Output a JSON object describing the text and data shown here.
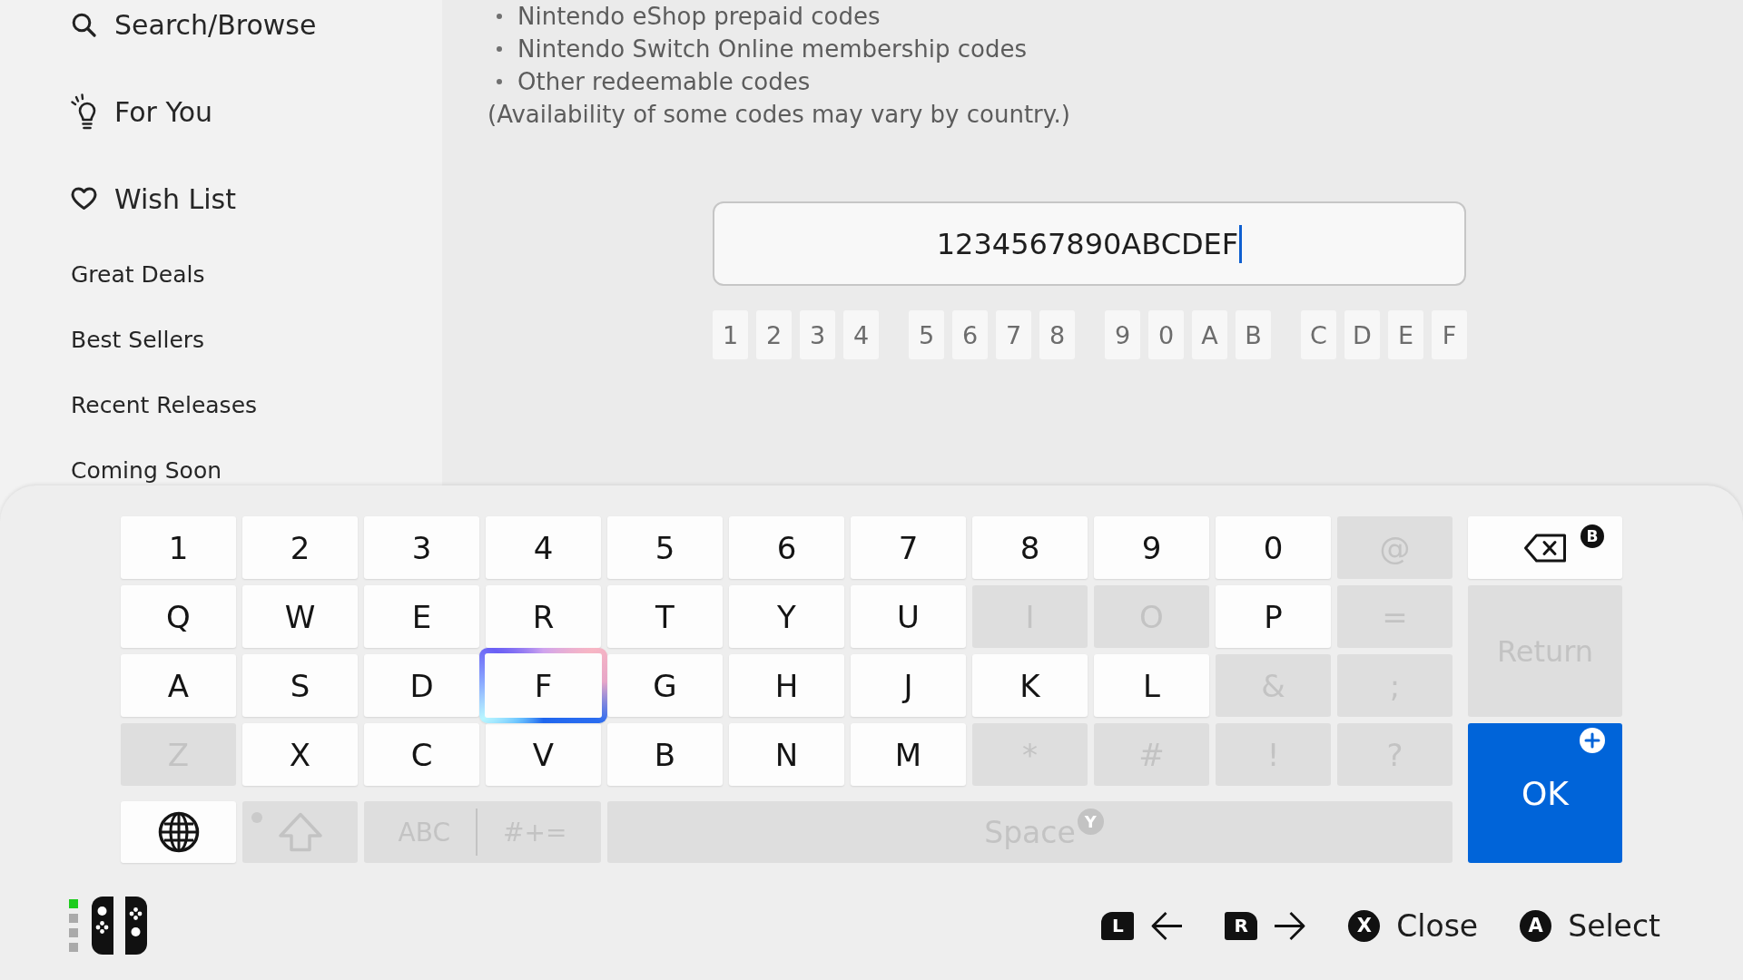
{
  "sidebar": {
    "items": [
      {
        "label": "Search/Browse",
        "kind": "main"
      },
      {
        "label": "For You",
        "kind": "main"
      },
      {
        "label": "Wish List",
        "kind": "main"
      },
      {
        "label": "Great Deals",
        "kind": "sub"
      },
      {
        "label": "Best Sellers",
        "kind": "sub"
      },
      {
        "label": "Recent Releases",
        "kind": "sub"
      },
      {
        "label": "Coming Soon",
        "kind": "sub"
      }
    ]
  },
  "content": {
    "code_types": [
      "Nintendo eShop prepaid codes",
      "Nintendo Switch Online membership codes",
      "Other redeemable codes"
    ],
    "note": "(Availability of some codes may vary by country.)",
    "code_field": {
      "value": "1234567890ABCDEF",
      "caret": true
    },
    "code_groups": [
      [
        "1",
        "2",
        "3",
        "4"
      ],
      [
        "5",
        "6",
        "7",
        "8"
      ],
      [
        "9",
        "0",
        "A",
        "B"
      ],
      [
        "C",
        "D",
        "E",
        "F"
      ]
    ]
  },
  "keyboard": {
    "rows": [
      [
        {
          "label": "1",
          "disabled": false,
          "selected": false
        },
        {
          "label": "2",
          "disabled": false,
          "selected": false
        },
        {
          "label": "3",
          "disabled": false,
          "selected": false
        },
        {
          "label": "4",
          "disabled": false,
          "selected": false
        },
        {
          "label": "5",
          "disabled": false,
          "selected": false
        },
        {
          "label": "6",
          "disabled": false,
          "selected": false
        },
        {
          "label": "7",
          "disabled": false,
          "selected": false
        },
        {
          "label": "8",
          "disabled": false,
          "selected": false
        },
        {
          "label": "9",
          "disabled": false,
          "selected": false
        },
        {
          "label": "0",
          "disabled": false,
          "selected": false
        },
        {
          "label": "@",
          "disabled": true,
          "selected": false
        }
      ],
      [
        {
          "label": "Q",
          "disabled": false,
          "selected": false
        },
        {
          "label": "W",
          "disabled": false,
          "selected": false
        },
        {
          "label": "E",
          "disabled": false,
          "selected": false
        },
        {
          "label": "R",
          "disabled": false,
          "selected": false
        },
        {
          "label": "T",
          "disabled": false,
          "selected": false
        },
        {
          "label": "Y",
          "disabled": false,
          "selected": false
        },
        {
          "label": "U",
          "disabled": false,
          "selected": false
        },
        {
          "label": "I",
          "disabled": true,
          "selected": false
        },
        {
          "label": "O",
          "disabled": true,
          "selected": false
        },
        {
          "label": "P",
          "disabled": false,
          "selected": false
        },
        {
          "label": "=",
          "disabled": true,
          "selected": false
        }
      ],
      [
        {
          "label": "A",
          "disabled": false,
          "selected": false
        },
        {
          "label": "S",
          "disabled": false,
          "selected": false
        },
        {
          "label": "D",
          "disabled": false,
          "selected": false
        },
        {
          "label": "F",
          "disabled": false,
          "selected": true
        },
        {
          "label": "G",
          "disabled": false,
          "selected": false
        },
        {
          "label": "H",
          "disabled": false,
          "selected": false
        },
        {
          "label": "J",
          "disabled": false,
          "selected": false
        },
        {
          "label": "K",
          "disabled": false,
          "selected": false
        },
        {
          "label": "L",
          "disabled": false,
          "selected": false
        },
        {
          "label": "&",
          "disabled": true,
          "selected": false
        },
        {
          "label": ";",
          "disabled": true,
          "selected": false
        }
      ],
      [
        {
          "label": "Z",
          "disabled": true,
          "selected": false
        },
        {
          "label": "X",
          "disabled": false,
          "selected": false
        },
        {
          "label": "C",
          "disabled": false,
          "selected": false
        },
        {
          "label": "V",
          "disabled": false,
          "selected": false
        },
        {
          "label": "B",
          "disabled": false,
          "selected": false
        },
        {
          "label": "N",
          "disabled": false,
          "selected": false
        },
        {
          "label": "M",
          "disabled": false,
          "selected": false
        },
        {
          "label": "*",
          "disabled": true,
          "selected": false
        },
        {
          "label": "#",
          "disabled": true,
          "selected": false
        },
        {
          "label": "!",
          "disabled": true,
          "selected": false
        },
        {
          "label": "?",
          "disabled": true,
          "selected": false
        }
      ]
    ],
    "backspace": {
      "badge": "B",
      "disabled": false,
      "selected": false
    },
    "return_key": {
      "label": "Return",
      "disabled": true,
      "selected": false
    },
    "ok_key": {
      "label": "OK",
      "selected": false
    },
    "bottom_row": [
      {
        "kind": "globe",
        "disabled": false,
        "selected": false
      },
      {
        "kind": "shift",
        "disabled": true,
        "selected": false
      },
      {
        "kind": "modes",
        "labels": [
          "ABC",
          "#+="
        ],
        "disabled": true,
        "selected": false
      },
      {
        "kind": "space",
        "label": "Space",
        "badge": "Y",
        "disabled": true,
        "selected": false
      }
    ]
  },
  "controller": {
    "lights": [
      {
        "on": true
      },
      {
        "on": false
      },
      {
        "on": false
      },
      {
        "on": false
      }
    ]
  },
  "hints": [
    {
      "kind": "prev",
      "key": "L"
    },
    {
      "kind": "next",
      "key": "R"
    },
    {
      "kind": "face",
      "key": "X",
      "label": "Close"
    },
    {
      "kind": "face",
      "key": "A",
      "label": "Select"
    }
  ]
}
